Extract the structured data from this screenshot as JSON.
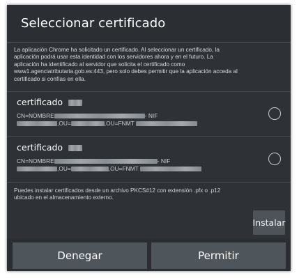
{
  "dialog": {
    "title": "Seleccionar certificado",
    "info_lines": [
      "La aplicación Chrome ha solicitado un certificado. Al seleccionar un certificado, la",
      "aplicación podrá usar esta identidad con los servidores ahora y en el futuro. La",
      "aplicación ha identificado al servidor que solicita el certificado como",
      "www1.agenciatributaria.gob.es:443, pero solo debes permitir que la aplicación acceda al",
      "certificado si confías en ella."
    ]
  },
  "certificates": [
    {
      "name": "certificado",
      "line1_prefix": "CN=NOMBRE",
      "line1_suffix": "- NIF",
      "line2_ou1": ",OU=",
      "line2_ou2": ",OU=FNMT",
      "selected": false
    },
    {
      "name": "certificado",
      "line1_prefix": "CN=NOMBRE",
      "line1_suffix": "- NIF",
      "line2_ou1": ",OU=",
      "line2_ou2": ",OU=FNMT",
      "selected": false
    }
  ],
  "install_note": [
    "Puedes instalar certificados desde un archivo PKCS#12 con extensión .pfx o .p12",
    "ubicado en el almacenamiento externo."
  ],
  "buttons": {
    "install": "Instalar",
    "deny": "Denegar",
    "allow": "Permitir"
  }
}
